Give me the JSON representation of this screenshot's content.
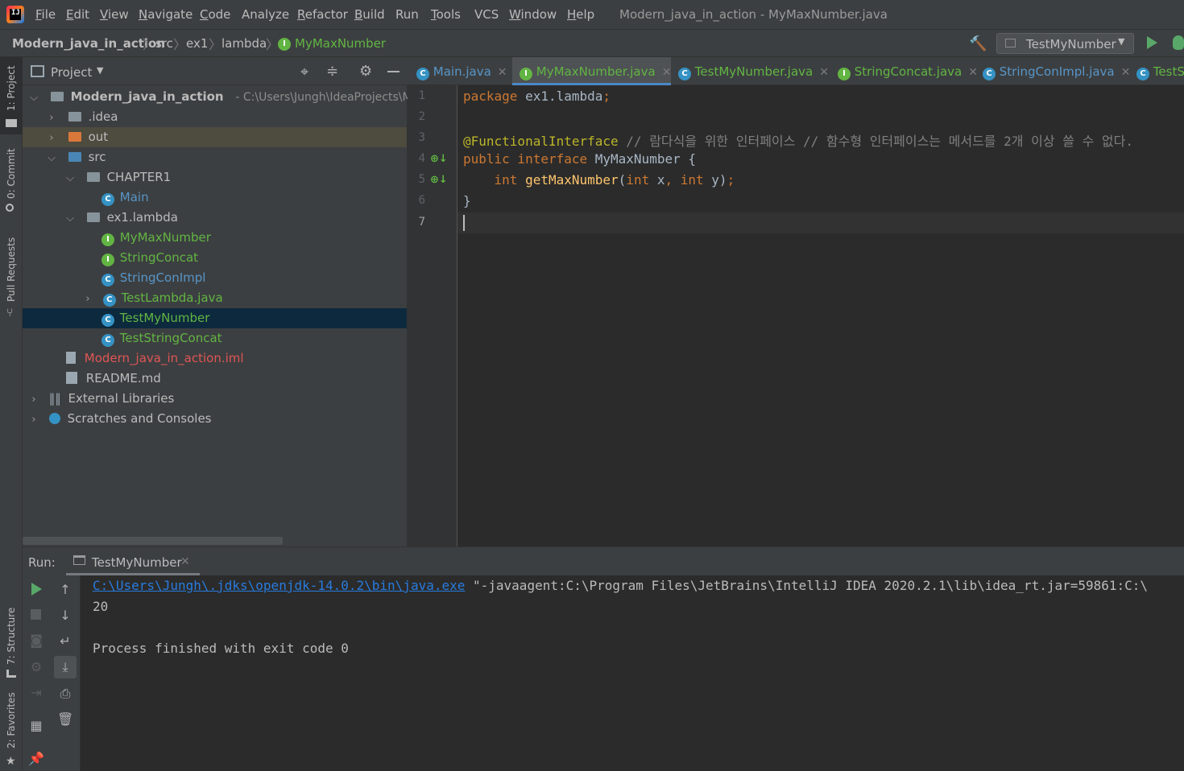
{
  "menubar": {
    "items": [
      {
        "label": "File",
        "u": "F",
        "rest": "ile"
      },
      {
        "label": "Edit",
        "u": "E",
        "rest": "dit"
      },
      {
        "label": "View",
        "u": "V",
        "rest": "iew"
      },
      {
        "label": "Navigate",
        "u": "N",
        "rest": "avigate"
      },
      {
        "label": "Code",
        "u": "C",
        "rest": "ode"
      },
      {
        "label": "Analyze",
        "u": "",
        "rest": "Analyze"
      },
      {
        "label": "Refactor",
        "u": "R",
        "rest": "efactor"
      },
      {
        "label": "Build",
        "u": "B",
        "rest": "uild"
      },
      {
        "label": "Run",
        "u": "",
        "rest": "Run"
      },
      {
        "label": "Tools",
        "u": "T",
        "rest": "ools"
      },
      {
        "label": "VCS",
        "u": "",
        "rest": "VCS"
      },
      {
        "label": "Window",
        "u": "W",
        "rest": "indow"
      },
      {
        "label": "Help",
        "u": "H",
        "rest": "elp"
      }
    ],
    "window_title": "Modern_java_in_action - MyMaxNumber.java"
  },
  "navbar": {
    "crumbs": [
      "Modern_java_in_action",
      "src",
      "ex1",
      "lambda",
      "MyMaxNumber"
    ],
    "run_config": "TestMyNumber"
  },
  "left_strip": {
    "tabs": [
      "1: Project",
      "0: Commit",
      "Pull Requests",
      "7: Structure",
      "2: Favorites"
    ]
  },
  "project": {
    "title": "Project",
    "root_name": "Modern_java_in_action",
    "root_path": "- C:\\Users\\Jungh\\IdeaProjects\\Moc",
    "nodes": {
      "idea": ".idea",
      "out": "out",
      "src": "src",
      "chapter1": "CHAPTER1",
      "main": "Main",
      "ex1_lambda": "ex1.lambda",
      "mymaxnumber": "MyMaxNumber",
      "stringconcat": "StringConcat",
      "stringconimpl": "StringConImpl",
      "testlambda": "TestLambda.java",
      "testmynumber": "TestMyNumber",
      "teststringconcat": "TestStringConcat",
      "iml": "Modern_java_in_action.iml",
      "readme": "README.md",
      "ext_libs": "External Libraries",
      "scratches": "Scratches and Consoles"
    }
  },
  "editor": {
    "tabs": [
      "Main.java",
      "MyMaxNumber.java",
      "TestMyNumber.java",
      "StringConcat.java",
      "StringConImpl.java",
      "TestS"
    ],
    "active_tab": "MyMaxNumber.java",
    "line_numbers": [
      "1",
      "2",
      "3",
      "4",
      "5",
      "6",
      "7"
    ],
    "code": {
      "l1_kw": "package",
      "l1_rest": " ex1.lambda",
      "l1_semi": ";",
      "l3_ann": "@FunctionalInterface",
      "l3_cmt": " // 람다식을 위한 인터페이스 // 함수형 인터페이스는 메서드를 2개 이상 쓸 수 없다.",
      "l4_kw": "public interface",
      "l4_rest": " MyMaxNumber {",
      "l5_indent": "    ",
      "l5_kw1": "int",
      "l5_fn": " getMaxNumber",
      "l5_p1": "(",
      "l5_kw2": "int",
      "l5_x": " x",
      "l5_comma": ", ",
      "l5_kw3": "int",
      "l5_y": " y)",
      "l5_semi": ";",
      "l6": "}"
    }
  },
  "run": {
    "label": "Run:",
    "tab": "TestMyNumber",
    "console_link": "C:\\Users\\Jungh\\.jdks\\openjdk-14.0.2\\bin\\java.exe",
    "console_cmd": " \"-javaagent:C:\\Program Files\\JetBrains\\IntelliJ IDEA 2020.2.1\\lib\\idea_rt.jar=59861:C:\\",
    "output_value": "20",
    "exit_message": "Process finished with exit code 0"
  }
}
